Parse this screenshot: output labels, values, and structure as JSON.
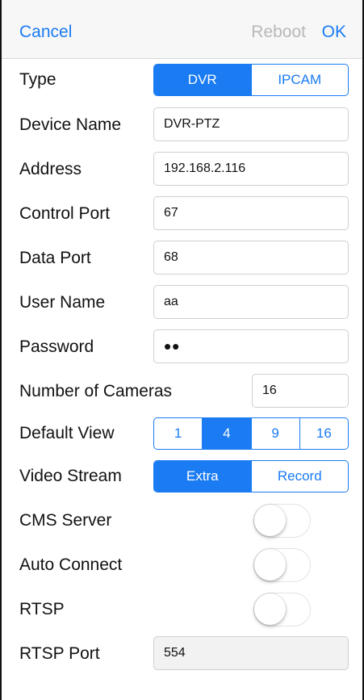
{
  "navbar": {
    "cancel_label": "Cancel",
    "reboot_label": "Reboot",
    "ok_label": "OK"
  },
  "form": {
    "type": {
      "label": "Type",
      "options": [
        "DVR",
        "IPCAM"
      ],
      "selected": "DVR"
    },
    "device_name": {
      "label": "Device Name",
      "value": "DVR-PTZ"
    },
    "address": {
      "label": "Address",
      "value": "192.168.2.116"
    },
    "control_port": {
      "label": "Control Port",
      "value": "67"
    },
    "data_port": {
      "label": "Data Port",
      "value": "68"
    },
    "user_name": {
      "label": "User Name",
      "value": "aa"
    },
    "password": {
      "label": "Password",
      "value": "••"
    },
    "number_of_cameras": {
      "label": "Number of Cameras",
      "value": "16"
    },
    "default_view": {
      "label": "Default View",
      "options": [
        "1",
        "4",
        "9",
        "16"
      ],
      "selected": "4"
    },
    "video_stream": {
      "label": "Video Stream",
      "options": [
        "Extra",
        "Record"
      ],
      "selected": "Extra"
    },
    "cms_server": {
      "label": "CMS Server",
      "on": false
    },
    "auto_connect": {
      "label": "Auto Connect",
      "on": false
    },
    "rtsp": {
      "label": "RTSP",
      "on": false
    },
    "rtsp_port": {
      "label": "RTSP Port",
      "value": "554"
    }
  },
  "colors": {
    "accent": "#1a7bf2",
    "disabled_text": "#b8b8b8",
    "navbar_bg": "#f7f7f7"
  }
}
